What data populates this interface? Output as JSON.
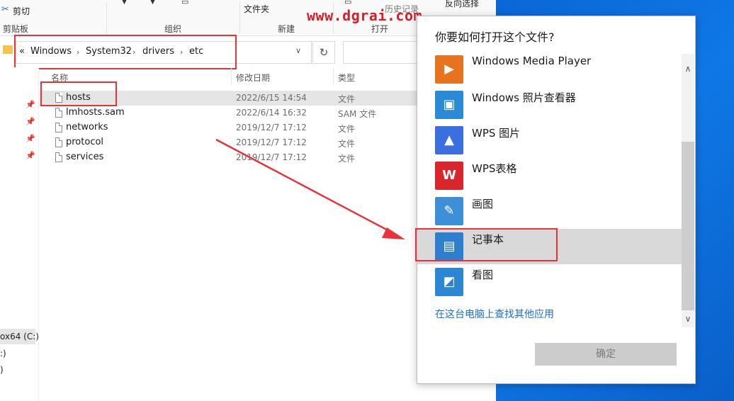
{
  "ribbon": {
    "cut": "剪切",
    "clipboard_group": "剪贴板",
    "organize_group": "组织",
    "new_folder": "文件夹",
    "new_group": "新建",
    "history": "历史记录",
    "open_group": "打开",
    "invert_select": "反向选择"
  },
  "address": {
    "prefix": "«",
    "crumbs": [
      "Windows",
      "System32",
      "drivers",
      "etc"
    ],
    "refresh_icon": "refresh-icon"
  },
  "columns": {
    "name": "名称",
    "modified": "修改日期",
    "type": "类型"
  },
  "files": [
    {
      "name": "hosts",
      "date": "2022/6/15 14:54",
      "type": "文件"
    },
    {
      "name": "lmhosts.sam",
      "date": "2022/6/14 16:32",
      "type": "SAM 文件"
    },
    {
      "name": "networks",
      "date": "2019/12/7 17:12",
      "type": "文件"
    },
    {
      "name": "protocol",
      "date": "2019/12/7 17:12",
      "type": "文件"
    },
    {
      "name": "services",
      "date": "2019/12/7 17:12",
      "type": "文件"
    }
  ],
  "nav": {
    "drive_label": "ox64 (C:)",
    "item2": ":)",
    "item3": ")"
  },
  "dialog": {
    "title": "你要如何打开这个文件?",
    "apps": [
      {
        "label": "Windows Media Player",
        "icon": "media-player-icon",
        "color": "#e8731e"
      },
      {
        "label": "Windows 照片查看器",
        "icon": "photo-viewer-icon",
        "color": "#2a8ad6"
      },
      {
        "label": "WPS 图片",
        "icon": "wps-picture-icon",
        "color": "#3b6fe0"
      },
      {
        "label": "WPS表格",
        "icon": "wps-sheet-icon",
        "color": "#d9262c"
      },
      {
        "label": "画图",
        "icon": "paint-icon",
        "color": "#3d8fd8"
      },
      {
        "label": "记事本",
        "icon": "notepad-icon",
        "color": "#2f7fd1"
      },
      {
        "label": "看图",
        "icon": "image-view-icon",
        "color": "#2c86d4"
      }
    ],
    "more_apps_link": "在这台电脑上查找其他应用",
    "ok_button": "确定"
  },
  "watermark": "www.dgrai.com",
  "colors": {
    "highlight_red": "#e8333a",
    "selection_gray": "#e5e5e5",
    "link_blue": "#1a6fd0",
    "desktop_blue": "#0f78e6"
  }
}
